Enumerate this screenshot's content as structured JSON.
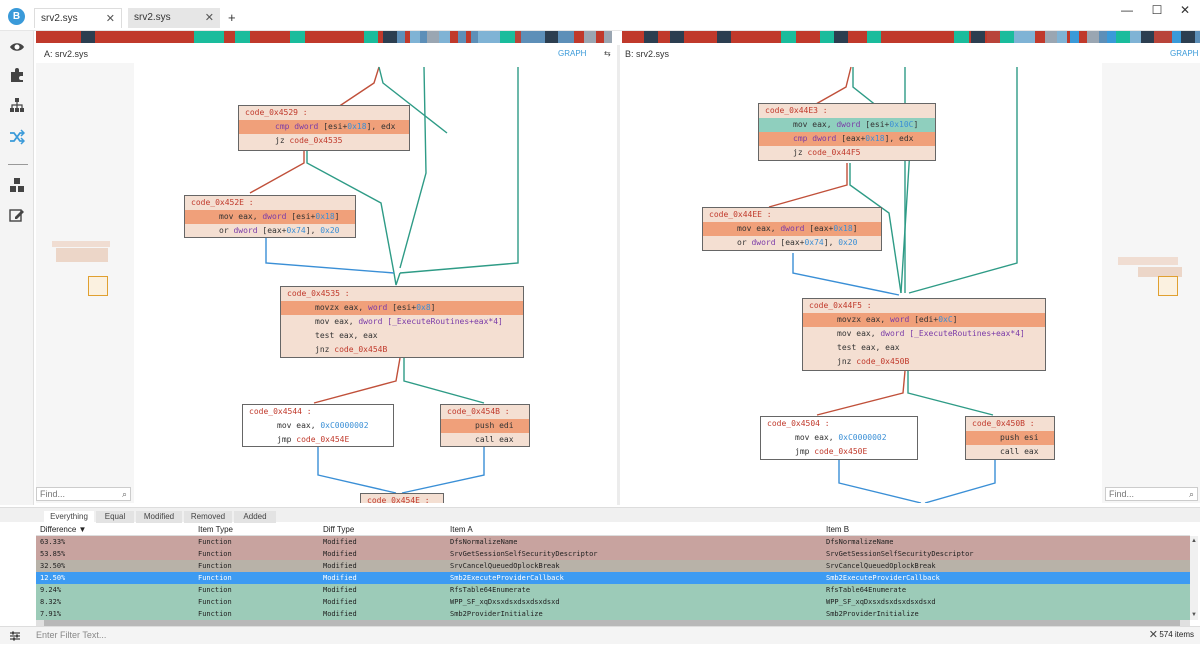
{
  "tabs": [
    {
      "label": "srv2.sys",
      "active": true
    },
    {
      "label": "srv2.sys",
      "active": false
    }
  ],
  "new_tab_label": "+",
  "window_controls": [
    "—",
    "☐",
    "✕"
  ],
  "sidebar_icons": [
    "eye-icon",
    "puzzle-icon",
    "hierarchy-icon",
    "shuffle-icon",
    "cubes-icon",
    "edit-icon"
  ],
  "pane_a": {
    "title": "A: srv2.sys",
    "mode": "GRAPH",
    "swap": "⇆",
    "find_placeholder": "Find..."
  },
  "pane_b": {
    "title": "B: srv2.sys",
    "mode": "GRAPH",
    "find_placeholder": "Find..."
  },
  "graph_a": {
    "b1": {
      "label": "code_0x4529 :",
      "l1": "cmp",
      "l1b": "dword",
      "l1c": "[esi+",
      "l1d": "0x18",
      "l1e": "], edx",
      "l2": "jz",
      "l2b": "code_0x4535"
    },
    "b2": {
      "label": "code_0x452E :",
      "l1": "mov eax,",
      "l1b": "dword",
      "l1c": "[esi+",
      "l1d": "0x18",
      "l1e": "]",
      "l2": "or",
      "l2b": "dword",
      "l2c": "[eax+",
      "l2d": "0x74",
      "l2e": "],",
      "l2f": "0x20"
    },
    "b3": {
      "label": "code_0x4535 :",
      "l1": "movzx eax,",
      "l1b": "word",
      "l1c": "[esi+",
      "l1d": "0x8",
      "l1e": "]",
      "l2": "mov eax,",
      "l2b": "dword",
      "l2c": "[_ExecuteRoutines+eax*4]",
      "l3": "test eax, eax",
      "l4": "jnz",
      "l4b": "code_0x454B"
    },
    "b4": {
      "label": "code_0x4544 :",
      "l1": "mov eax,",
      "l1b": "0xC0000002",
      "l2": "jmp",
      "l2b": "code_0x454E"
    },
    "b5": {
      "label": "code_0x454B :",
      "l1": "push edi",
      "l2": "call eax"
    },
    "b6": {
      "label": "code_0x454E :"
    }
  },
  "graph_b": {
    "b1": {
      "label": "code_0x44E3 :",
      "l1": "mov eax,",
      "l1b": "dword",
      "l1c": "[esi+",
      "l1d": "0x10C",
      "l1e": "]",
      "l2": "cmp",
      "l2b": "dword",
      "l2c": "[eax+",
      "l2d": "0x18",
      "l2e": "], edx",
      "l3": "jz",
      "l3b": "code_0x44F5"
    },
    "b2": {
      "label": "code_0x44EE :",
      "l1": "mov eax,",
      "l1b": "dword",
      "l1c": "[eax+",
      "l1d": "0x18",
      "l1e": "]",
      "l2": "or",
      "l2b": "dword",
      "l2c": "[eax+",
      "l2d": "0x74",
      "l2e": "],",
      "l2f": "0x20"
    },
    "b3": {
      "label": "code_0x44F5 :",
      "l1": "movzx eax,",
      "l1b": "word",
      "l1c": "[edi+",
      "l1d": "0xC",
      "l1e": "]",
      "l2": "mov eax,",
      "l2b": "dword",
      "l2c": "[_ExecuteRoutines+eax*4]",
      "l3": "test eax, eax",
      "l4": "jnz",
      "l4b": "code_0x450B"
    },
    "b4": {
      "label": "code_0x4504 :",
      "l1": "mov eax,",
      "l1b": "0xC0000002",
      "l2": "jmp",
      "l2b": "code_0x450E"
    },
    "b5": {
      "label": "code_0x450B :",
      "l1": "push esi",
      "l2": "call eax"
    }
  },
  "bottom_tabs": [
    "Everything",
    "Equal",
    "Modified",
    "Removed",
    "Added"
  ],
  "table": {
    "headers": [
      "Difference ▼",
      "Item Type",
      "Diff Type",
      "Item A",
      "Item B"
    ],
    "rows": [
      [
        "63.33%",
        "Function",
        "Modified",
        "DfsNormalizeName",
        "DfsNormalizeName"
      ],
      [
        "53.85%",
        "Function",
        "Modified",
        "SrvGetSessionSelfSecurityDescriptor",
        "SrvGetSessionSelfSecurityDescriptor"
      ],
      [
        "32.50%",
        "Function",
        "Modified",
        "SrvCancelQueuedOplockBreak",
        "SrvCancelQueuedOplockBreak"
      ],
      [
        "12.50%",
        "Function",
        "Modified",
        "Smb2ExecuteProviderCallback",
        "Smb2ExecuteProviderCallback"
      ],
      [
        "9.24%",
        "Function",
        "Modified",
        "RfsTable64Enumerate",
        "RfsTable64Enumerate"
      ],
      [
        "8.32%",
        "Function",
        "Modified",
        "WPP_SF_xqDxsxdsxdsxdsxdsxd",
        "WPP_SF_xqDxsxdsxdsxdsxdsxd"
      ],
      [
        "7.91%",
        "Function",
        "Modified",
        "Smb2ProviderInitialize",
        "Smb2ProviderInitialize"
      ]
    ]
  },
  "filter_placeholder": "Enter Filter Text...",
  "clear_label": "✕",
  "item_count": "574 items",
  "colors": {
    "accent": "#3a9ad9",
    "modified_high": "#c8a39f",
    "modified_mid": "#b8b2a8",
    "selected": "#3d9bf2",
    "similar": "#9ccbb8",
    "edge_red": "#c0503a",
    "edge_teal": "#2e9b86",
    "edge_blue": "#3a8fd6"
  }
}
